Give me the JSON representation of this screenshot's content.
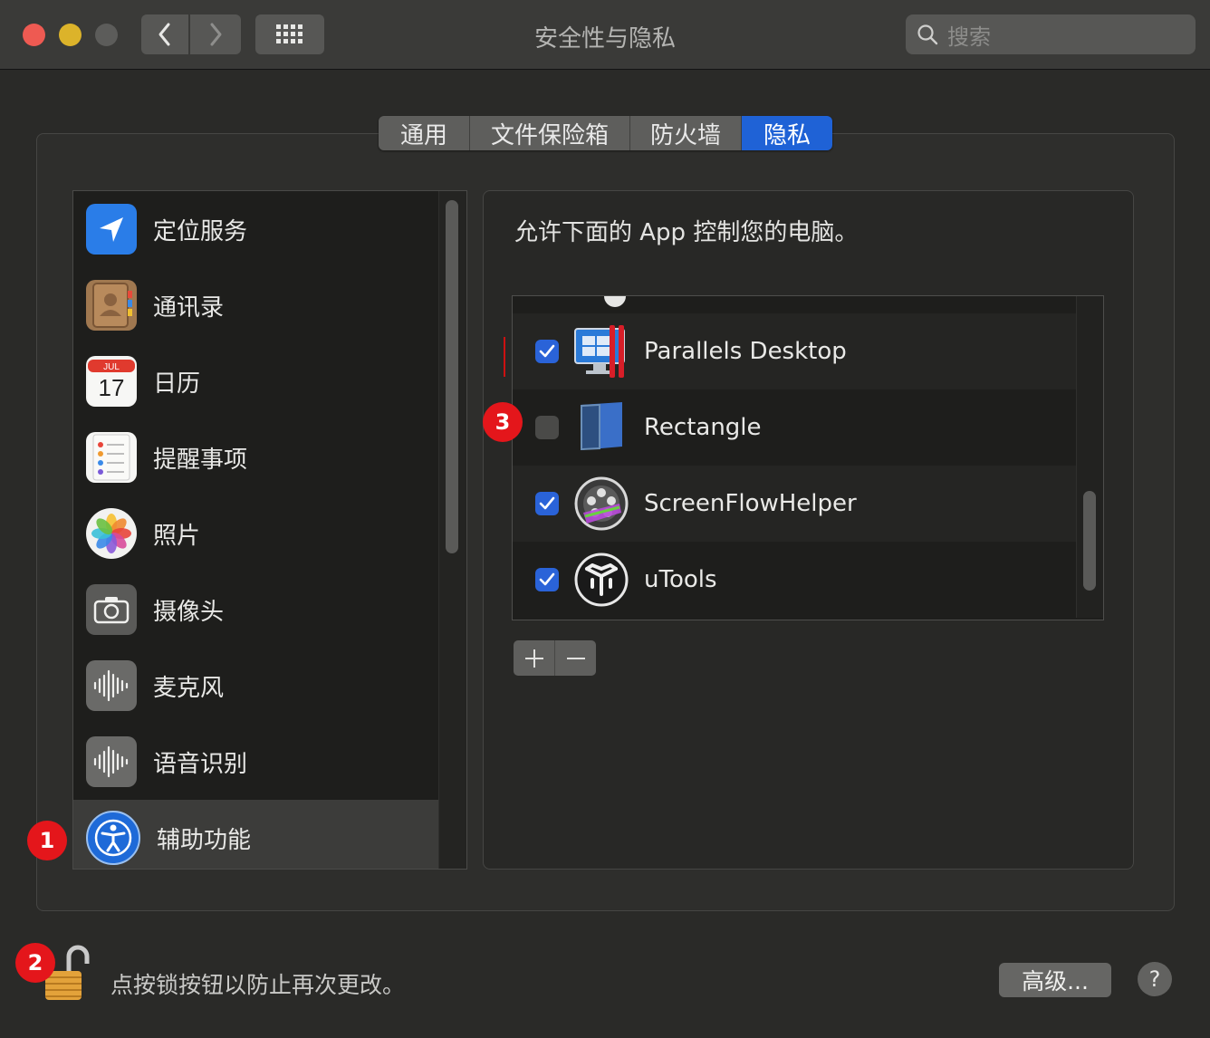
{
  "window": {
    "title": "安全性与隐私",
    "search_placeholder": "搜索"
  },
  "tabs": [
    {
      "label": "通用"
    },
    {
      "label": "文件保险箱"
    },
    {
      "label": "防火墙"
    },
    {
      "label": "隐私",
      "active": true
    }
  ],
  "sidebar": {
    "items": [
      {
        "label": "定位服务",
        "icon": "location-arrow-icon"
      },
      {
        "label": "通讯录",
        "icon": "contacts-book-icon"
      },
      {
        "label": "日历",
        "icon": "calendar-icon",
        "month": "JUL",
        "day": "17"
      },
      {
        "label": "提醒事项",
        "icon": "reminders-icon"
      },
      {
        "label": "照片",
        "icon": "photos-icon"
      },
      {
        "label": "摄像头",
        "icon": "camera-icon"
      },
      {
        "label": "麦克风",
        "icon": "microphone-waveform-icon"
      },
      {
        "label": "语音识别",
        "icon": "speech-waveform-icon"
      },
      {
        "label": "辅助功能",
        "icon": "accessibility-icon",
        "selected": true
      }
    ]
  },
  "panel": {
    "description": "允许下面的 App 控制您的电脑。",
    "apps": [
      {
        "name": "Parallels Desktop",
        "checked": true,
        "icon": "parallels-icon"
      },
      {
        "name": "Rectangle",
        "checked": false,
        "icon": "rectangle-icon"
      },
      {
        "name": "ScreenFlowHelper",
        "checked": true,
        "icon": "screenflow-icon"
      },
      {
        "name": "uTools",
        "checked": true,
        "icon": "utools-icon"
      }
    ],
    "add_label": "+",
    "remove_label": "−"
  },
  "footer": {
    "lock_text": "点按锁按钮以防止再次更改。",
    "advanced_label": "高级...",
    "help_label": "?"
  },
  "annotations": [
    {
      "label": "1"
    },
    {
      "label": "2"
    },
    {
      "label": "3"
    }
  ],
  "colors": {
    "accent": "#1f62d6",
    "badge": "#e4161b",
    "window_bg": "#2a2a28"
  }
}
